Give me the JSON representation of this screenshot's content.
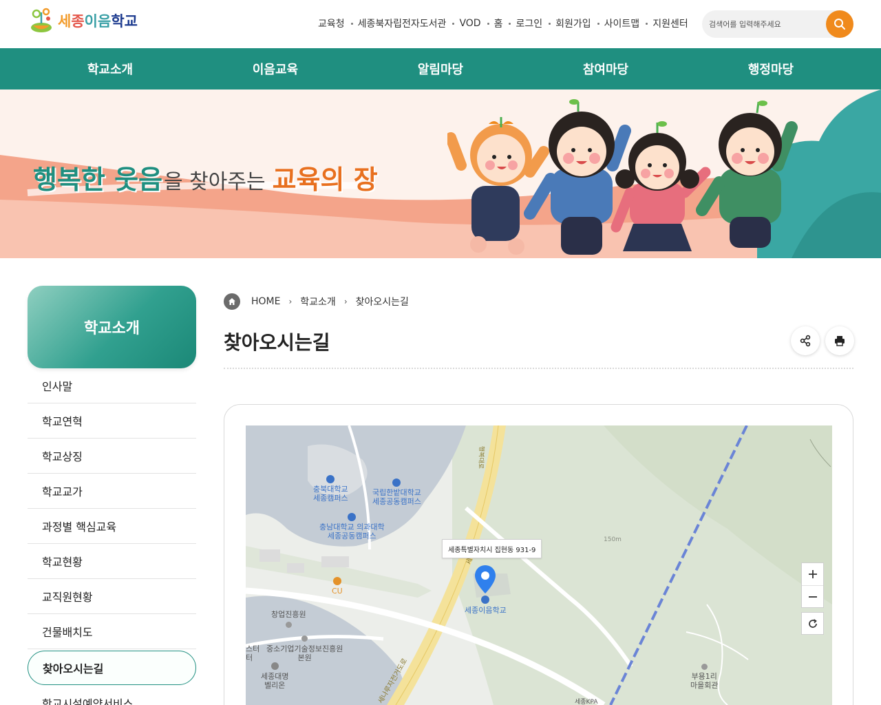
{
  "header": {
    "logo_text": "세종이음학교",
    "util_links": [
      "교육청",
      "세종북자립전자도서관",
      "VOD",
      "홈",
      "로그인",
      "회원가입",
      "사이트맵",
      "지원센터"
    ],
    "search": {
      "placeholder": "검색어를 입력해주세요"
    }
  },
  "gnb": {
    "items": [
      "학교소개",
      "이음교육",
      "알림마당",
      "참여마당",
      "행정마당"
    ]
  },
  "banner": {
    "slogan_part1": "행복한 웃음",
    "slogan_part2": "을 찾아주는",
    "slogan_part3": "교육의 장"
  },
  "sidebar": {
    "title": "학교소개",
    "items": [
      {
        "label": "인사말"
      },
      {
        "label": "학교연혁"
      },
      {
        "label": "학교상징"
      },
      {
        "label": "학교교가"
      },
      {
        "label": "과정별 핵심교육"
      },
      {
        "label": "학교현황"
      },
      {
        "label": "교직원현황"
      },
      {
        "label": "건물배치도"
      },
      {
        "label": "찾아오시는길"
      },
      {
        "label": "학교시설예약서비스"
      }
    ],
    "active_index": 8
  },
  "breadcrumb": {
    "home": "HOME",
    "level1": "학교소개",
    "level2": "찾아오시는길"
  },
  "page": {
    "title": "찾아오시는길"
  },
  "map": {
    "address_tooltip": "세종특별자치시 집현동 931-9",
    "marker_label": "세종이음학교",
    "labels": {
      "chungbuk": "충북대학교\n세종캠퍼스",
      "hanbat": "국립한밭대학교\n세종공동캠퍼스",
      "chungnam": "충남대학교 의과대학\n세종공동캠퍼스",
      "cu": "CU",
      "changup": "창업진흥원",
      "smba": "중소기업기술정보진흥원\n본원",
      "center": "스터\n터",
      "daemyung": "세종대명\n벨리온",
      "buyong": "부용1리\n마을회관",
      "road1": "행복대로",
      "road2": "세나루길",
      "road3": "세나루자전거도로",
      "elev": "150m",
      "kpa": "세종KPA"
    }
  },
  "colors": {
    "primary": "#1f8f80",
    "accent": "#f08a1c"
  }
}
